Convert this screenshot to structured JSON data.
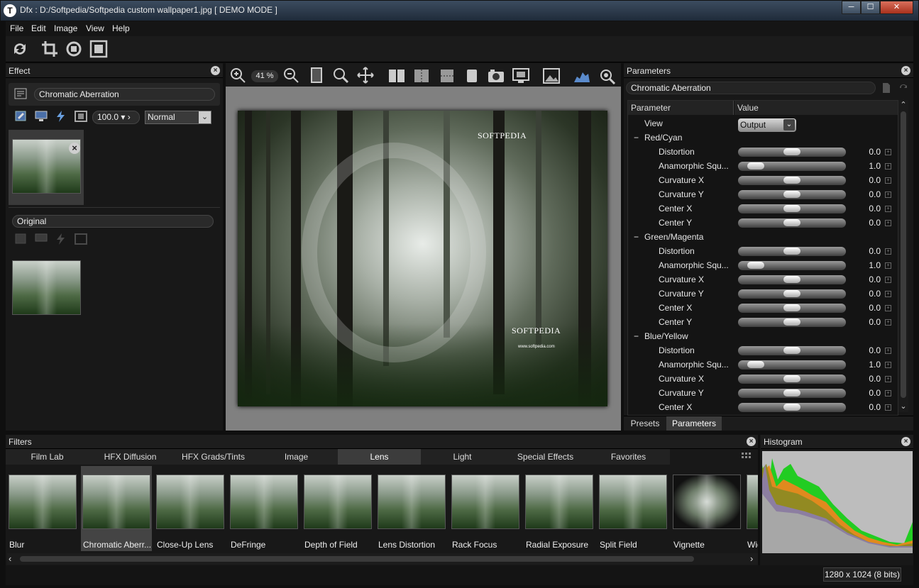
{
  "window": {
    "title": "Dfx : D:/Softpedia/Softpedia custom wallpaper1.jpg [ DEMO MODE ]",
    "app_icon": "T"
  },
  "window_controls": {
    "minimize": "─",
    "maximize": "☐",
    "close": "✕"
  },
  "menu": [
    "File",
    "Edit",
    "Image",
    "View",
    "Help"
  ],
  "toolbar": [
    "refresh-icon",
    "crop-icon",
    "rotate-icon",
    "fit-screen-icon"
  ],
  "effect_panel": {
    "title": "Effect",
    "effect_name": "Chromatic Aberration",
    "opacity": "100.0",
    "blend_mode": "Normal",
    "original_label": "Original"
  },
  "viewer": {
    "zoom": "41 %",
    "watermark_1": "SOFTPEDIA",
    "watermark_2": "SOFTPEDIA",
    "url_text": "www.softpedia.com"
  },
  "params_panel": {
    "title": "Parameters",
    "effect_name": "Chromatic Aberration",
    "col_param": "Parameter",
    "col_value": "Value",
    "view_label": "View",
    "view_value": "Output",
    "groups": [
      {
        "name": "Red/Cyan",
        "rows": [
          {
            "name": "Distortion",
            "value": "0.0",
            "level": 0.5
          },
          {
            "name": "Anamorphic Squ...",
            "value": "1.0",
            "level": 0.1
          },
          {
            "name": "Curvature X",
            "value": "0.0",
            "level": 0.5
          },
          {
            "name": "Curvature Y",
            "value": "0.0",
            "level": 0.5
          },
          {
            "name": "Center X",
            "value": "0.0",
            "level": 0.5
          },
          {
            "name": "Center Y",
            "value": "0.0",
            "level": 0.5
          }
        ]
      },
      {
        "name": "Green/Magenta",
        "rows": [
          {
            "name": "Distortion",
            "value": "0.0",
            "level": 0.5
          },
          {
            "name": "Anamorphic Squ...",
            "value": "1.0",
            "level": 0.1
          },
          {
            "name": "Curvature X",
            "value": "0.0",
            "level": 0.5
          },
          {
            "name": "Curvature Y",
            "value": "0.0",
            "level": 0.5
          },
          {
            "name": "Center X",
            "value": "0.0",
            "level": 0.5
          },
          {
            "name": "Center Y",
            "value": "0.0",
            "level": 0.5
          }
        ]
      },
      {
        "name": "Blue/Yellow",
        "rows": [
          {
            "name": "Distortion",
            "value": "0.0",
            "level": 0.5
          },
          {
            "name": "Anamorphic Squ...",
            "value": "1.0",
            "level": 0.1
          },
          {
            "name": "Curvature X",
            "value": "0.0",
            "level": 0.5
          },
          {
            "name": "Curvature Y",
            "value": "0.0",
            "level": 0.5
          },
          {
            "name": "Center X",
            "value": "0.0",
            "level": 0.5
          }
        ]
      }
    ],
    "tabs": [
      "Presets",
      "Parameters"
    ]
  },
  "filters_panel": {
    "title": "Filters",
    "tabs": [
      "Film Lab",
      "HFX Diffusion",
      "HFX Grads/Tints",
      "Image",
      "Lens",
      "Light",
      "Special Effects",
      "Favorites"
    ],
    "active_tab": "Lens",
    "items": [
      "Blur",
      "Chromatic Aberr...",
      "Close-Up Lens",
      "DeFringe",
      "Depth of Field",
      "Lens Distortion",
      "Rack Focus",
      "Radial Exposure",
      "Split Field",
      "Vignette",
      "Wid"
    ]
  },
  "histogram": {
    "title": "Histogram"
  },
  "status": {
    "image_info": "1280 x 1024 (8 bits)"
  }
}
